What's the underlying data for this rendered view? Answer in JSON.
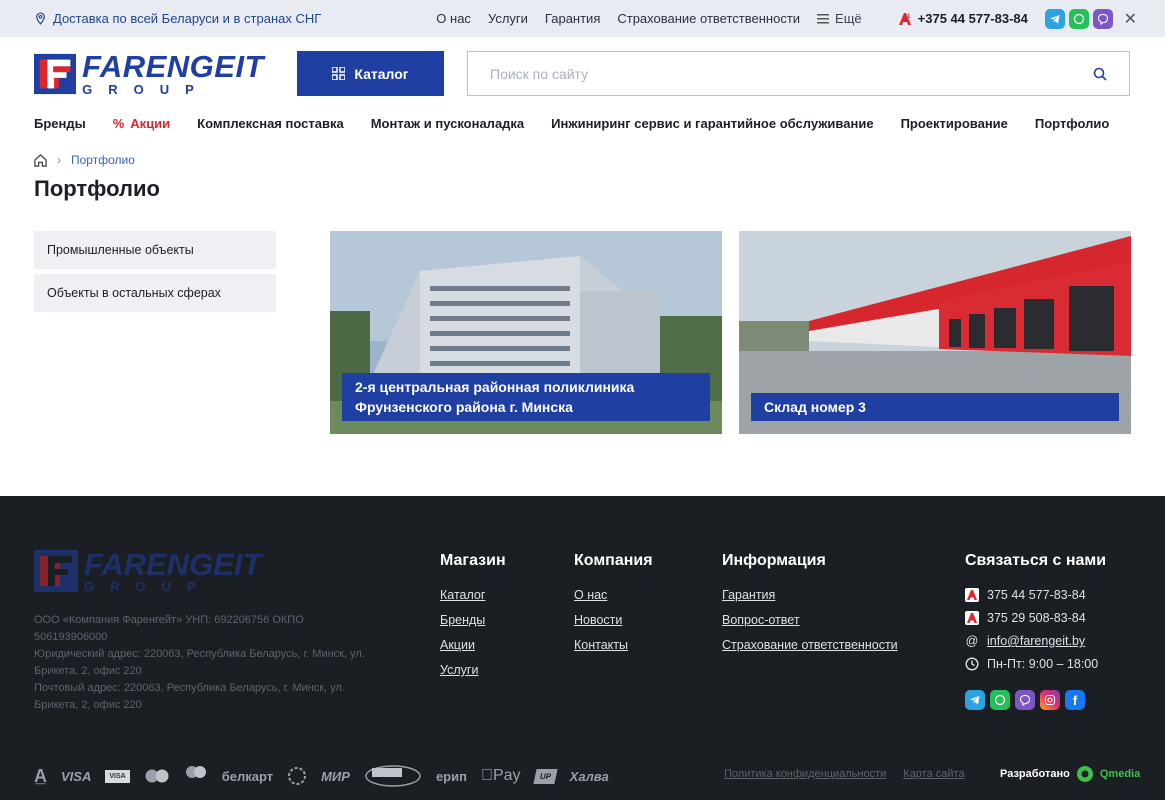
{
  "topbar": {
    "delivery": "Доставка по всей Беларуси и в странах СНГ",
    "links": [
      "О нас",
      "Услуги",
      "Гарантия",
      "Страхование ответственности"
    ],
    "more": "Ещё",
    "phone": "+375 44 577-83-84"
  },
  "header": {
    "brand_main": "FARENGEIT",
    "brand_sub": "GROUP",
    "catalog_label": "Каталог",
    "search_placeholder": "Поиск по сайту"
  },
  "nav": {
    "items": [
      "Бренды",
      "Акции",
      "Комплексная поставка",
      "Монтаж и пусконаладка",
      "Инжиниринг сервис и гарантийное обслуживание",
      "Проектирование",
      "Портфолио"
    ]
  },
  "breadcrumb": {
    "current": "Портфолио"
  },
  "page_title": "Портфолио",
  "sidebar": {
    "items": [
      "Промышленные объекты",
      "Объекты в остальных сферах"
    ]
  },
  "cards": [
    {
      "title": "2-я центральная районная поликлиника Фрунзенского района г. Минска"
    },
    {
      "title": "Склад номер 3"
    }
  ],
  "footer": {
    "company_lines": [
      "ООО «Компания Фаренгейт» УНП: 692206756 ОКПО 506193906000",
      "Юридический адрес: 220063, Республика Беларусь, г. Минск, ул. Брикета, 2, офис 220",
      "Почтовый адрес: 220063, Республика Беларусь, г. Минск, ул. Брикета, 2, офис 220"
    ],
    "shop": {
      "title": "Магазин",
      "links": [
        "Каталог",
        "Бренды",
        "Акции",
        "Услуги"
      ]
    },
    "company": {
      "title": "Компания",
      "links": [
        "О нас",
        "Новости",
        "Контакты"
      ]
    },
    "info": {
      "title": "Информация",
      "links": [
        "Гарантия",
        "Вопрос-ответ",
        "Страхование ответственности"
      ]
    },
    "contact": {
      "title": "Связаться с нами",
      "phone1": "375 44 577-83-84",
      "phone2": "375 29 508-83-84",
      "email": "info@farengeit.by",
      "hours": "Пн-Пт: 9:00 – 18:00"
    },
    "payments": [
      "VISA",
      "белкарт",
      "МИР",
      "ерип",
      "Pay",
      "Халва"
    ],
    "policy": "Политика конфиденциальности",
    "sitemap": "Карта сайта",
    "developed_by": "Разработано",
    "developer": "Qmedia"
  },
  "colors": {
    "brand_blue": "#1f3fa3",
    "accent_red": "#e0262d",
    "footer_bg": "#1b1e23"
  }
}
